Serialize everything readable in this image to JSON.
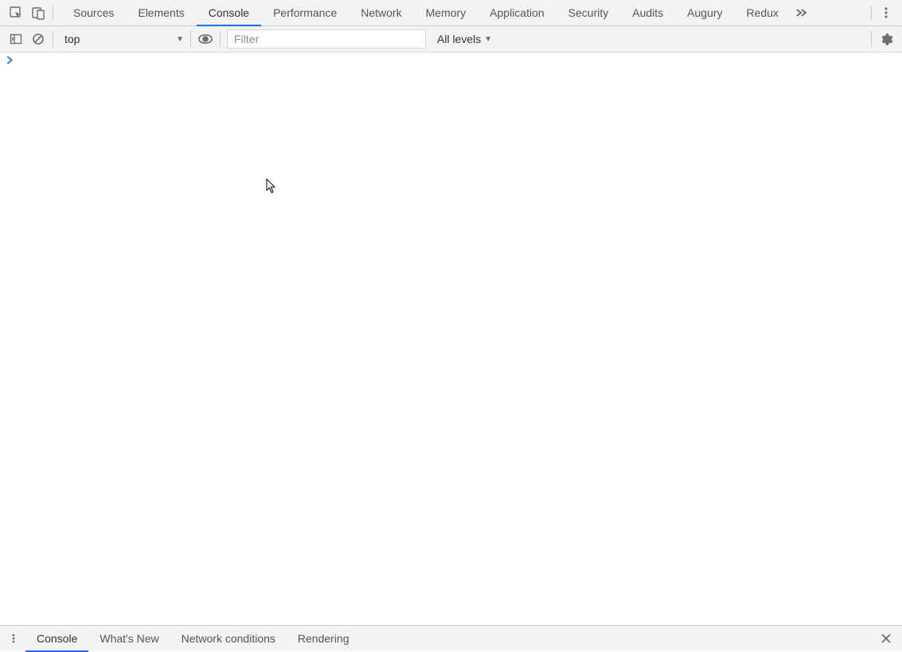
{
  "header": {
    "tabs": [
      {
        "label": "Sources",
        "active": false
      },
      {
        "label": "Elements",
        "active": false
      },
      {
        "label": "Console",
        "active": true
      },
      {
        "label": "Performance",
        "active": false
      },
      {
        "label": "Network",
        "active": false
      },
      {
        "label": "Memory",
        "active": false
      },
      {
        "label": "Application",
        "active": false
      },
      {
        "label": "Security",
        "active": false
      },
      {
        "label": "Audits",
        "active": false
      },
      {
        "label": "Augury",
        "active": false
      },
      {
        "label": "Redux",
        "active": false
      }
    ]
  },
  "console_toolbar": {
    "context": "top",
    "filter_placeholder": "Filter",
    "filter_value": "",
    "levels_label": "All levels"
  },
  "console_body": {
    "prompt": ">"
  },
  "drawer": {
    "tabs": [
      {
        "label": "Console",
        "active": true
      },
      {
        "label": "What's New",
        "active": false
      },
      {
        "label": "Network conditions",
        "active": false
      },
      {
        "label": "Rendering",
        "active": false
      }
    ]
  }
}
